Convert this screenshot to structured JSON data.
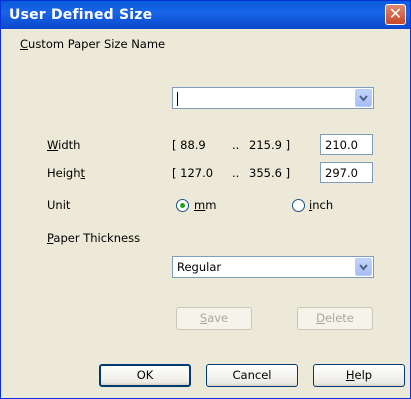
{
  "window": {
    "title": "User Defined Size",
    "close_glyph": "✕"
  },
  "custom_paper_size": {
    "label_u": "C",
    "label_rest": "ustom Paper Size Name",
    "value": ""
  },
  "width": {
    "label_u": "W",
    "label_rest": "idth",
    "range_min": "[ 88.9",
    "dots": "..",
    "range_max": "215.9 ]",
    "value": "210.0"
  },
  "height": {
    "label_pre": "Heigh",
    "label_u": "t",
    "range_min": "[ 127.0",
    "dots": "..",
    "range_max": "355.6 ]",
    "value": "297.0"
  },
  "unit": {
    "label": "Unit",
    "mm_u": "m",
    "mm_rest": "m",
    "inch_u": "i",
    "inch_rest": "nch",
    "selected": "mm"
  },
  "paper_thickness": {
    "label_u": "P",
    "label_rest": "aper Thickness",
    "value": "Regular"
  },
  "buttons": {
    "save_u": "S",
    "save_rest": "ave",
    "delete_u": "D",
    "delete_rest": "elete",
    "ok": "OK",
    "cancel": "Cancel",
    "help_u": "H",
    "help_rest": "elp"
  },
  "colors": {
    "title_bar": "#0a5cdb",
    "dialog_bg": "#ece9d8",
    "radio_selected": "#21a121"
  }
}
